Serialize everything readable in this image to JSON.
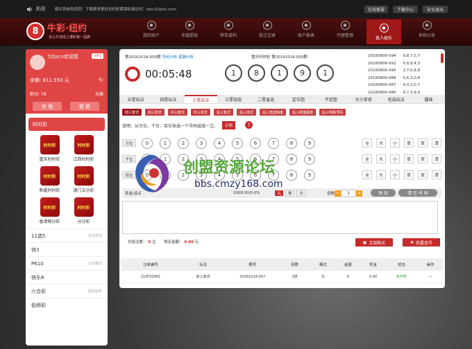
{
  "topbar": {
    "close_label": "关闭",
    "marquee": "娱乐系统欢迎您！下载更多更好玩的彩票源码请访问：bbs.52jscn.com",
    "btn_online": "在线客服",
    "btn_download": "下载中心",
    "btn_logout": "安全退出"
  },
  "logo": {
    "badge": "8",
    "name": "牛彩·纽约",
    "slogan": "全心打造线上博彩第一品牌"
  },
  "nav": [
    {
      "label": "我的账户",
      "icon": "user-icon"
    },
    {
      "label": "充值提现",
      "icon": "wallet-icon"
    },
    {
      "label": "荐奖返利",
      "icon": "gift-icon"
    },
    {
      "label": "投注记录",
      "icon": "record-icon"
    },
    {
      "label": "账户报表",
      "icon": "report-icon"
    },
    {
      "label": "代理管理",
      "icon": "agent-icon"
    },
    {
      "label": "真人娱乐",
      "icon": "live-icon"
    },
    {
      "label": "系统公告",
      "icon": "notice-icon"
    }
  ],
  "user": {
    "welcome": "52jscn欢迎您",
    "vip": "VIP1",
    "balance": "余额: 811.550 元",
    "points": "积分: 78",
    "redeem": "兑换",
    "recharge": "充 值",
    "withdraw": "提 款"
  },
  "sidebar": {
    "ssc_title": "时时彩",
    "games": [
      {
        "name": "重庆时时彩",
        "icon_text": "时时彩"
      },
      {
        "name": "江西时时彩",
        "icon_text": "时时彩"
      },
      {
        "name": "新疆时时彩",
        "icon_text": "时时彩"
      },
      {
        "name": "澳门五分彩",
        "icon_text": "时时彩"
      },
      {
        "name": "香港两分彩",
        "icon_text": "时时彩"
      },
      {
        "name": "分分彩",
        "icon_text": "时时彩"
      }
    ],
    "categories": [
      {
        "name": "11选5",
        "sub": "玩法多样"
      },
      {
        "name": "快3",
        "sub": ""
      },
      {
        "name": "PK10",
        "sub": "北京赛车"
      },
      {
        "name": "快乐8",
        "sub": ""
      },
      {
        "name": "六合彩",
        "sub": "超高返奖"
      },
      {
        "name": "低频彩",
        "sub": ""
      }
    ]
  },
  "lottery": {
    "current_issue": "第20161018-059期",
    "trend_link": "号码分布·遗漏分析",
    "countdown": "00:05:48",
    "last_issue": "重庆时时彩 第20161018-058期",
    "balls": [
      "1",
      "8",
      "1",
      "9",
      "1"
    ],
    "history": [
      {
        "issue": "20160806-094",
        "nums": "0,8,7,0,7"
      },
      {
        "issue": "20160806-092",
        "nums": "5,8,9,4,3"
      },
      {
        "issue": "20160806-090",
        "nums": "2,7,0,8,8"
      },
      {
        "issue": "20160806-088",
        "nums": "5,6,3,0,8"
      },
      {
        "issue": "20160806-087",
        "nums": "4,0,3,0,7"
      },
      {
        "issue": "20160806-086",
        "nums": "9,7,3,9,9"
      }
    ]
  },
  "tabs": [
    "五星玩法",
    "四星玩法",
    "三星玩法",
    "三星组选",
    "二星直选",
    "定位胆",
    "不定胆",
    "大小单双",
    "任选玩法",
    "趣味"
  ],
  "active_tab": 2,
  "subtabs": [
    "前三复式",
    "前三单式",
    "中三复式",
    "中三单式",
    "后三复式",
    "后三单式",
    "后三直选跨度",
    "后三和值尾数",
    "后三特殊号码"
  ],
  "desc": "说明：从万位、千位、百位各选一个号码组成一注。",
  "example_btn": "示例",
  "positions": [
    "万位",
    "千位",
    "百位"
  ],
  "digits": [
    "0",
    "1",
    "2",
    "3",
    "4",
    "5",
    "6",
    "7",
    "8",
    "9"
  ],
  "quick": [
    "全",
    "大",
    "小",
    "单",
    "双",
    "清"
  ],
  "betbar": {
    "mode_label": "奖金/返点",
    "rebate": "1958.00/0.0%",
    "mode": "元",
    "mode2": "角",
    "mode3": "分",
    "multiple_label": "倍数",
    "multiple_value": "1",
    "add": "添 加",
    "clear": "清 空 号 码"
  },
  "summary": {
    "count_label": "总投注数：",
    "count": "0",
    "count_unit": "注",
    "amount_label": "购买金额：",
    "amount": "0.00",
    "amount_unit": "元",
    "buy_now": "立刻购买",
    "chase": "我要追号"
  },
  "table": {
    "headers": [
      "注单编号",
      "玩法",
      "期号",
      "倍数",
      "模式",
      "金额",
      "奖金",
      "状态",
      "操作"
    ],
    "rows": [
      [
        "110FZOWZ",
        "前三复式",
        "20161018-057",
        "2倍",
        "元",
        "4",
        "0.00",
        "未开奖",
        "---"
      ]
    ]
  },
  "watermark": {
    "title": "创盟资源论坛",
    "url": "bbs.cmzy168.com"
  },
  "colors": {
    "brand": "#c62b2b",
    "status_pending": "#2a9a2a"
  }
}
